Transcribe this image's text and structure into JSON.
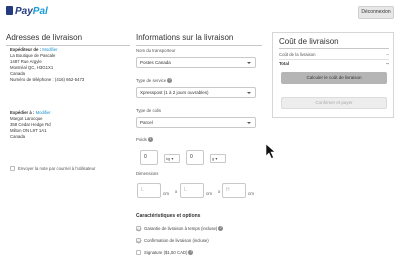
{
  "header": {
    "logo_text_1": "Pay",
    "logo_text_2": "Pal",
    "logout_label": "Déconnexion"
  },
  "left": {
    "title": "Adresses de livraison",
    "sender": {
      "label": "Expéditeur de : ",
      "edit": "Modifier",
      "lines": [
        "La Boutique de Pascale",
        "1487 Rue Argyle",
        "Montréal QC, H3G1X1",
        "Canada",
        "Numéro de téléphone : (416) 662-5473"
      ]
    },
    "recipient": {
      "label": "Expédier à : ",
      "edit": "Modifier",
      "lines": [
        "Margot Larocque",
        "358 Cedar Hedge Rd",
        "Milton ON L9T 1A1",
        "Canada"
      ]
    },
    "send_note_label": "Envoyer la note par courriel à l'utilisateur"
  },
  "middle": {
    "title": "Informations sur la livraison",
    "carrier_label": "Nom du transporteur",
    "carrier_value": "Postes Canada",
    "service_label": "Type de service",
    "service_value": "Xpresspost (1 à 2 jours ouvrables)",
    "package_label": "Type de colis",
    "package_value": "Parcel",
    "weight_label": "Poids",
    "weight_kg_value": "0",
    "weight_kg_unit": "kg",
    "weight_g_value": "0",
    "weight_g_unit": "g",
    "dimensions_label": "Dimensions",
    "dim_l_placeholder": "L",
    "dim_w_placeholder": "L",
    "dim_h_placeholder": "H",
    "dim_unit": "cm",
    "dim_sep": "x",
    "options_title": "Caractéristiques et options",
    "options": [
      {
        "label": "Garantie de livraison à temps (incluse)",
        "checked": true,
        "help": true
      },
      {
        "label": "Confirmation de livraison (incluse)",
        "checked": true,
        "help": false
      },
      {
        "label": "Signature ($1,50 CAD)",
        "checked": false,
        "help": true
      }
    ]
  },
  "panel": {
    "title": "Coût de livraison",
    "rows": [
      {
        "label": "Coût de la livraison",
        "value": "--"
      },
      {
        "label": "Total",
        "value": "--"
      }
    ],
    "calc_button": "Calculer le coût de livraison",
    "confirm_button": "Confirmer et payer"
  },
  "colors": {
    "paypal_dark": "#253b80",
    "paypal_light": "#179bd7",
    "link": "#1a8fd1"
  }
}
